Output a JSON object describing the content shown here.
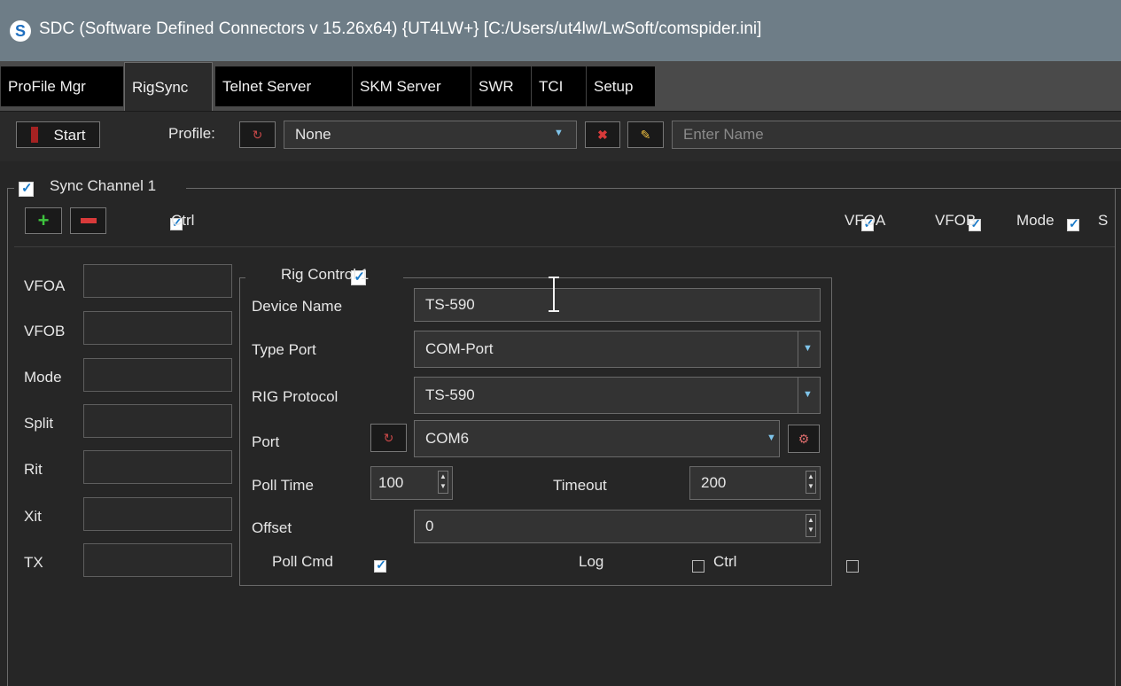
{
  "window": {
    "title": "SDC (Software Defined Connectors v 15.26x64) {UT4LW+} [C:/Users/ut4lw/LwSoft/comspider.ini]"
  },
  "tabs": [
    "ProFile Mgr",
    "RigSync",
    "Telnet Server",
    "SKM Server",
    "SWR",
    "TCI",
    "Setup"
  ],
  "toolbar": {
    "start_label": "Start",
    "profile_label": "Profile:",
    "profile_value": "None",
    "name_placeholder": "Enter Name"
  },
  "sync": {
    "channel_label": "Sync Channel 1",
    "ctrl_label": "Ctrl",
    "right_checks": [
      "VFOA",
      "VFOB",
      "Mode",
      "S"
    ],
    "left_labels": [
      "VFOA",
      "VFOB",
      "Mode",
      "Split",
      "Rit",
      "Xit",
      "TX"
    ]
  },
  "rig": {
    "group_label": "Rig Control 1",
    "device_name_label": "Device Name",
    "device_name_value": "TS-590",
    "type_port_label": "Type Port",
    "type_port_value": "COM-Port",
    "protocol_label": "RIG Protocol",
    "protocol_value": "TS-590",
    "port_label": "Port",
    "port_value": "COM6",
    "poll_time_label": "Poll Time",
    "poll_time_value": "100",
    "timeout_label": "Timeout",
    "timeout_value": "200",
    "offset_label": "Offset",
    "offset_value": "0",
    "poll_cmd_label": "Poll Cmd",
    "log_label": "Log",
    "ctrl_label": "Ctrl"
  },
  "colors": {
    "titlebar": "#6e7d87",
    "background": "#262626",
    "accent": "#1a7ac8"
  }
}
